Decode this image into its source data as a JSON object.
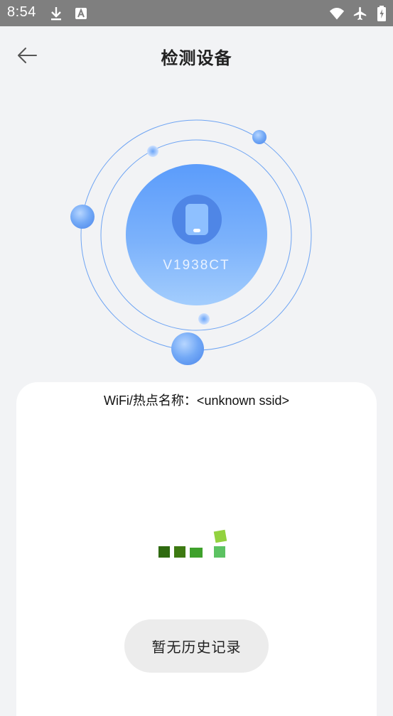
{
  "status_bar": {
    "time": "8:54",
    "icons": [
      "download-icon",
      "font-a-icon",
      "wifi-icon",
      "airplane-icon",
      "battery-icon"
    ]
  },
  "header": {
    "title": "检测设备",
    "back_icon": "arrow-left-icon"
  },
  "device": {
    "name": "V1938CT",
    "icon": "phone-icon"
  },
  "card": {
    "wifi_text": "WiFi/热点名称：<unknown ssid>",
    "loader_icon": "loading-blocks-icon",
    "history_button": "暂无历史记录"
  },
  "colors": {
    "status_bar": "#7f7f7f",
    "background": "#f2f3f5",
    "core_top": "#5b9cfb",
    "core_bottom": "#a3cdfd",
    "orbit_line": "#6ea4f3",
    "loader_dark": "#2f6a10",
    "loader_green": "#3fa12c",
    "loader_light": "#93d23f"
  }
}
